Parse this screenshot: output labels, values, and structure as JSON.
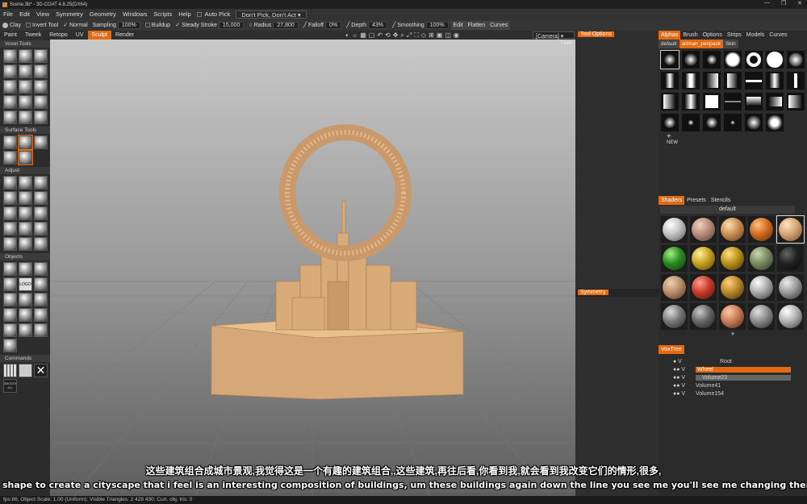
{
  "window": {
    "title": "Scene.3b* - 3D-COAT 4.8.25(DX64)"
  },
  "menu": {
    "items": [
      "File",
      "Edit",
      "View",
      "Symmetry",
      "Geometry",
      "Windows",
      "Scripts",
      "Help"
    ],
    "auto_pick": "Auto Pick",
    "pick_mode": "Don't Pick, Don't Act"
  },
  "toolbar": {
    "clay": "Clay",
    "invert": "Invert Tool",
    "normal": "Normal",
    "sampling": "Sampling",
    "sampling_val": "100%",
    "buildup": "Buildup",
    "steady": "Steady Stroke",
    "steady_val": "15,000",
    "radius": "Radius",
    "radius_val": "27,800",
    "falloff": "Falloff",
    "falloff_val": "0%",
    "depth": "Depth",
    "depth_val": "43%",
    "smoothing": "Smoothing",
    "smoothing_val": "100%",
    "edit": "Edit",
    "flatten": "Flatten",
    "curves": "Curves"
  },
  "rooms": [
    "Paint",
    "Tweek",
    "Retopo",
    "UV",
    "Sculpt",
    "Render"
  ],
  "active_room": "Sculpt",
  "viewport": {
    "camera": "[Camera]",
    "view": "Front"
  },
  "left": {
    "voxel_tools": "Voxel Tools",
    "surface_tools": "Surface Tools",
    "adjust": "Adjust",
    "objects": "Objects",
    "commands": "Commands",
    "logo_label": "LOGO",
    "smooth_label": "SMOOTH ALL"
  },
  "mid": {
    "tool_options": "Tool Options",
    "symmetry": "Symmetry"
  },
  "alphas": {
    "tabs": [
      "Alphas",
      "Brush",
      "Options",
      "Strips",
      "Models",
      "Curves"
    ],
    "subtabs": [
      "default",
      "artman_penpack",
      "Skin"
    ],
    "new_label": "NEW"
  },
  "shaders": {
    "tabs": [
      "Shaders",
      "Presets",
      "Stencils"
    ],
    "preset": "default"
  },
  "voxtree": {
    "title": "VoxTree",
    "items": [
      {
        "name": "Root"
      },
      {
        "name": "Wheel"
      },
      {
        "name": "Volume23"
      },
      {
        "name": "Volume41"
      },
      {
        "name": "Volume154"
      }
    ]
  },
  "status": {
    "text": "fps:86;  Object Scale: 1.00 (Uniform); Visible Triangles: 2 428 430; Curr. obj. tris: 0"
  },
  "subtitles": {
    "zh": "这些建筑组合成城市景观,我觉得这是一个有趣的建筑组合,,这些建筑,再往后看,你看到我,就会看到我改变它们的情形,很多,",
    "en": "shape to create a cityscape that i feel is an interesting composition of buildings, um these buildings again down the line you see me you'll see me changing them quite a co"
  },
  "colors": {
    "accent": "#e36a10",
    "clay": "#d4a373"
  }
}
